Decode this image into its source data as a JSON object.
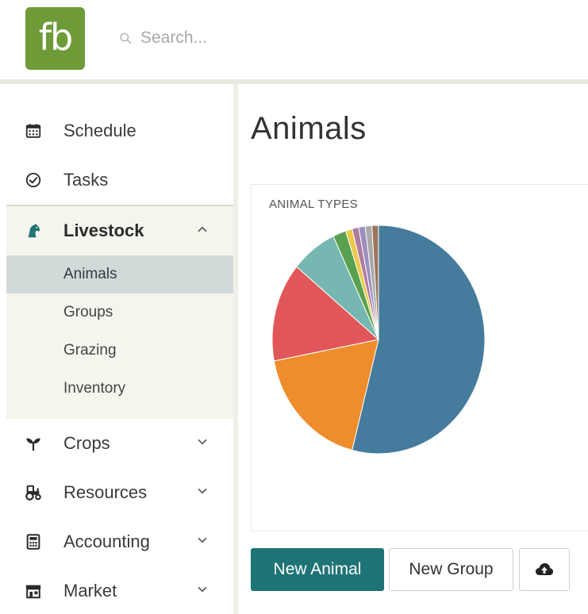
{
  "header": {
    "logo_text": "fb",
    "search_placeholder": "Search...",
    "icons": {
      "search": "search-icon"
    }
  },
  "sidebar": {
    "items": [
      {
        "label": "Schedule",
        "icon": "calendar-icon"
      },
      {
        "label": "Tasks",
        "icon": "check-circle-icon"
      },
      {
        "label": "Livestock",
        "icon": "horse-icon",
        "expanded": true
      },
      {
        "label": "Crops",
        "icon": "sprout-icon"
      },
      {
        "label": "Resources",
        "icon": "tractor-icon"
      },
      {
        "label": "Accounting",
        "icon": "calculator-icon"
      },
      {
        "label": "Market",
        "icon": "store-icon"
      }
    ],
    "livestock_subitems": [
      {
        "label": "Animals",
        "active": true
      },
      {
        "label": "Groups"
      },
      {
        "label": "Grazing"
      },
      {
        "label": "Inventory"
      }
    ]
  },
  "main": {
    "title": "Animals",
    "chart_card_title": "ANIMAL TYPES",
    "buttons": {
      "new_animal": "New Animal",
      "new_group": "New Group",
      "upload_icon": "cloud-upload-icon"
    }
  },
  "colors": {
    "brand_green": "#6e9b38",
    "primary_teal": "#1e7375",
    "active_nav_bg": "#d2dad9",
    "submenu_bg": "#f5f5ee"
  },
  "chart_data": {
    "type": "pie",
    "title": "ANIMAL TYPES",
    "values": [
      54,
      18,
      14,
      7,
      2,
      1,
      1,
      1,
      1,
      1
    ],
    "colors": [
      "#457b9d",
      "#ef8c2b",
      "#e15759",
      "#76b7b2",
      "#59a14f",
      "#edc948",
      "#b07aa1",
      "#9c8fbd",
      "#a9a9a9",
      "#9c755f"
    ]
  }
}
